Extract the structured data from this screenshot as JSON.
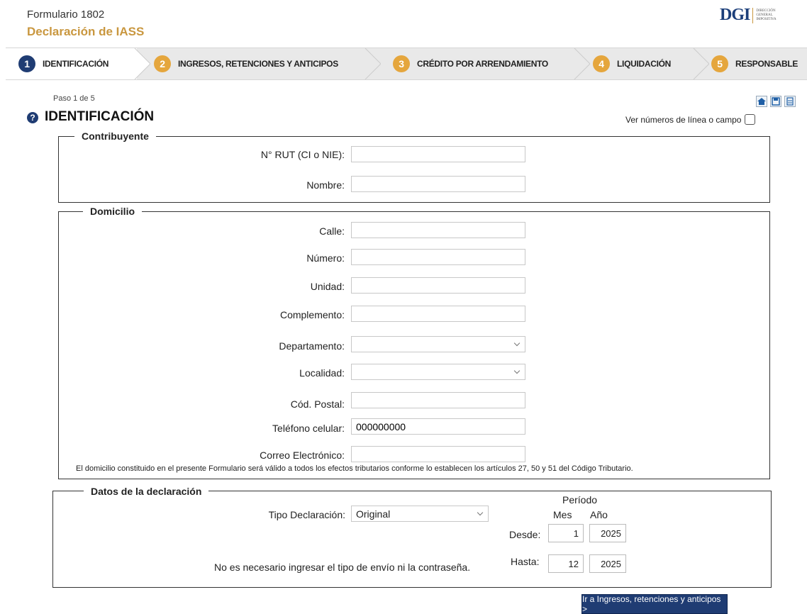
{
  "header": {
    "form_number": "Formulario 1802",
    "form_title": "Declaración de IASS",
    "logo_text": "DGI",
    "logo_sub": [
      "DIRECCIÓN",
      "GENERAL",
      "IMPOSITIVA"
    ]
  },
  "steps": [
    {
      "num": "1",
      "label": "IDENTIFICACIÓN",
      "active": true
    },
    {
      "num": "2",
      "label": "INGRESOS, RETENCIONES Y ANTICIPOS",
      "active": false
    },
    {
      "num": "3",
      "label": "CRÉDITO POR ARRENDAMIENTO",
      "active": false
    },
    {
      "num": "4",
      "label": "LIQUIDACIÓN",
      "active": false
    },
    {
      "num": "5",
      "label": "RESPONSABLE",
      "active": false
    }
  ],
  "page": {
    "paso": "Paso 1 de 5",
    "title": "IDENTIFICACIÓN",
    "help_icon": "?",
    "ver_numeros": "Ver números de línea o campo",
    "tools": [
      "home-icon",
      "save-icon",
      "print-icon"
    ]
  },
  "contribuyente": {
    "legend": "Contribuyente",
    "rut_label": "N° RUT (CI o NIE):",
    "rut_value": "",
    "nombre_label": "Nombre:",
    "nombre_value": ""
  },
  "domicilio": {
    "legend": "Domicilio",
    "calle_label": "Calle:",
    "numero_label": "Número:",
    "unidad_label": "Unidad:",
    "complemento_label": "Complemento:",
    "departamento_label": "Departamento:",
    "departamento_value": "",
    "localidad_label": "Localidad:",
    "localidad_value": "",
    "postal_label": "Cód. Postal:",
    "telefono_label": "Teléfono celular:",
    "telefono_value": "000000000",
    "correo_label": "Correo Electrónico:",
    "note": "El domicilio constituido en el presente Formulario será válido a todos los efectos tributarios  conforme lo establecen los artículos 27, 50 y 51 del Código Tributario."
  },
  "declaracion": {
    "legend": "Datos de la declaración",
    "tipo_label": "Tipo Declaración:",
    "tipo_value": "Original",
    "periodo": "Período",
    "mes": "Mes",
    "anio": "Año",
    "desde_label": "Desde:",
    "desde_mes": "1",
    "desde_anio": "2025",
    "hasta_label": "Hasta:",
    "hasta_mes": "12",
    "hasta_anio": "2025",
    "note": "No es necesario ingresar el tipo de envío ni la contraseña."
  },
  "next_button": "Ir a Ingresos, retenciones y anticipos  >",
  "colors": {
    "accent": "#c9973f",
    "step_num": "#e5a63d",
    "primary": "#1f3c73"
  }
}
